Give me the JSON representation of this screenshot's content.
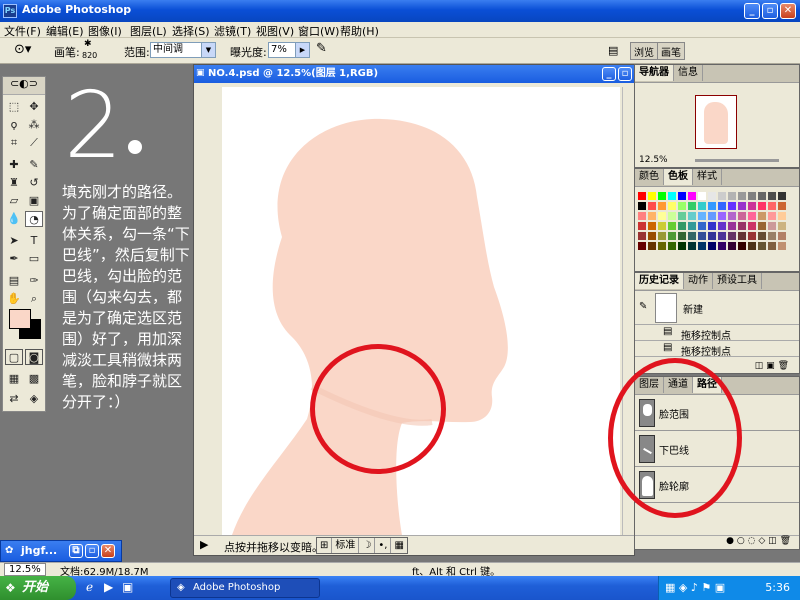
{
  "window": {
    "title": "Adobe Photoshop"
  },
  "menu": [
    "文件(F)",
    "编辑(E)",
    "图像(I)",
    "图层(L)",
    "选择(S)",
    "滤镜(T)",
    "视图(V)",
    "窗口(W)",
    "帮助(H)"
  ],
  "options": {
    "brush_label": "画笔:",
    "brush_size": "820",
    "range_label": "范围:",
    "range_value": "中间调",
    "exposure_label": "曝光度:",
    "exposure_value": "7%"
  },
  "top_tabs": [
    "浏览",
    "画笔"
  ],
  "tutorial": {
    "step_number": "2",
    "text": "填充刚才的路径。为了确定面部的整体关系，勾一条“下巴线”，然后复制下巴线，勾出脸的范围（勾来勾去，都是为了确定选区范围）好了，用加深减淡工具稍微抹两笔，脸和脖子就区分开了：）"
  },
  "document": {
    "title": "NO.4.psd @ 12.5%(图层 1,RGB)",
    "status_tip": "点按并拖移以变暗。",
    "ime": [
      "标准",
      "☽",
      "•,",
      "▦"
    ]
  },
  "navigator": {
    "tabs": [
      "导航器",
      "信息"
    ],
    "zoom": "12.5%"
  },
  "color_panel": {
    "tabs": [
      "颜色",
      "色板",
      "样式"
    ],
    "swatches": [
      "#ff0000",
      "#ffff00",
      "#00ff00",
      "#00ffff",
      "#0000ff",
      "#ff00ff",
      "#ffffff",
      "#e6e6e6",
      "#cccccc",
      "#b3b3b3",
      "#999999",
      "#808080",
      "#666666",
      "#4d4d4d",
      "#333333",
      "#000000",
      "#ff4d4d",
      "#ff9933",
      "#ffff66",
      "#99ff66",
      "#33cc66",
      "#33cccc",
      "#3399ff",
      "#3366ff",
      "#6633ff",
      "#9933cc",
      "#cc3399",
      "#ff3366",
      "#ff6666",
      "#cc6633",
      "#ff8080",
      "#ffb366",
      "#ffff99",
      "#ccff99",
      "#66cc99",
      "#66cccc",
      "#66b3ff",
      "#6699ff",
      "#9966ff",
      "#b366cc",
      "#cc6699",
      "#ff6699",
      "#cc9966",
      "#ff9999",
      "#ffcc99",
      "#cc3333",
      "#cc6600",
      "#cccc33",
      "#66cc33",
      "#339966",
      "#339999",
      "#3366cc",
      "#3333cc",
      "#6633cc",
      "#993399",
      "#993366",
      "#cc3366",
      "#996633",
      "#cc9999",
      "#ccb380",
      "#993333",
      "#994d00",
      "#999933",
      "#4d9933",
      "#336633",
      "#336666",
      "#334d99",
      "#333399",
      "#4d3399",
      "#663366",
      "#663333",
      "#993333",
      "#664d33",
      "#998066",
      "#b38066",
      "#660000",
      "#663300",
      "#666600",
      "#336600",
      "#003300",
      "#003333",
      "#003366",
      "#000066",
      "#330066",
      "#330033",
      "#330000",
      "#4d3319",
      "#665533",
      "#806040",
      "#c09070"
    ]
  },
  "history": {
    "tabs": [
      "历史记录",
      "动作",
      "预设工具"
    ],
    "snapshot": "新建",
    "items": [
      "拖移控制点",
      "拖移控制点"
    ]
  },
  "paths": {
    "tabs": [
      "图层",
      "通道",
      "路径"
    ],
    "items": [
      "脸范围",
      "下巴线",
      "脸轮廓"
    ]
  },
  "minimized_window": {
    "title": "jhgf..."
  },
  "app_status": {
    "zoom": "12.5%",
    "doc_label": "文档:62.9M/18.7M",
    "hint": "ft、Alt 和 Ctrl 键。"
  },
  "taskbar": {
    "start_label": "开始",
    "task": "Adobe Photoshop",
    "clock": "5:36"
  },
  "colors": {
    "skin": "#fad7c8",
    "highlight_circle": "#e0141e"
  }
}
